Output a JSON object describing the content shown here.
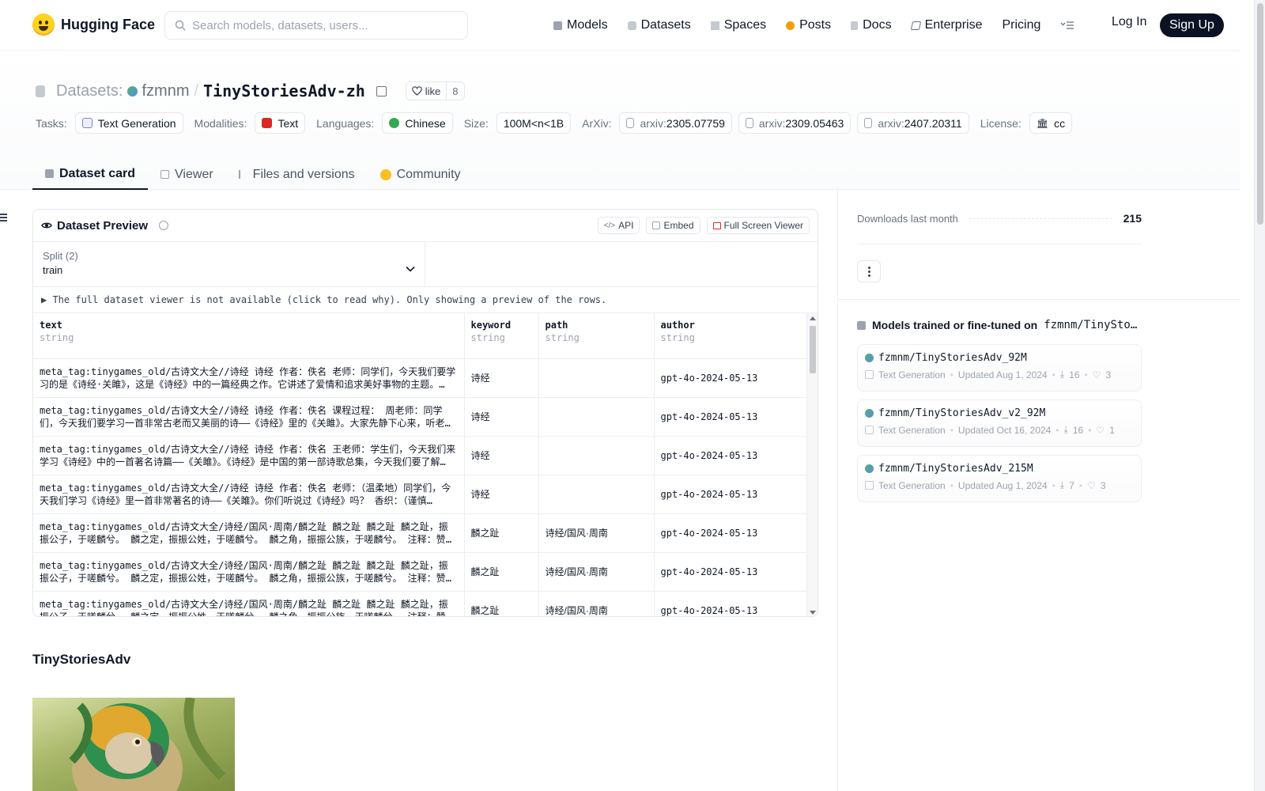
{
  "nav": {
    "brand": "Hugging Face",
    "search_placeholder": "Search models, datasets, users...",
    "links": [
      "Models",
      "Datasets",
      "Spaces",
      "Posts",
      "Docs",
      "Enterprise",
      "Pricing"
    ],
    "login": "Log In",
    "signup": "Sign Up"
  },
  "header": {
    "section": "Datasets:",
    "user": "fzmnm",
    "separator": "/",
    "repo": "TinyStoriesAdv-zh",
    "like_label": "like",
    "like_count": "8",
    "tags": {
      "tasks_label": "Tasks:",
      "task": "Text Generation",
      "modalities_label": "Modalities:",
      "modality": "Text",
      "languages_label": "Languages:",
      "language": "Chinese",
      "size_label": "Size:",
      "size": "100M<n<1B",
      "arxiv_label": "ArXiv:",
      "arxiv_prefix": "arxiv:",
      "arxiv": [
        "2305.07759",
        "2309.05463",
        "2407.20311"
      ],
      "license_label": "License:",
      "license": "cc"
    },
    "tabs": [
      "Dataset card",
      "Viewer",
      "Files and versions",
      "Community"
    ]
  },
  "preview": {
    "title": "Dataset Preview",
    "api": "API",
    "embed": "Embed",
    "fullscreen": "Full Screen Viewer",
    "split_label": "Split (2)",
    "split_value": "train",
    "notice": "▶ The full dataset viewer is not available (click to read why). Only showing a preview of the rows.",
    "columns": [
      {
        "name": "text",
        "type": "string"
      },
      {
        "name": "keyword",
        "type": "string"
      },
      {
        "name": "path",
        "type": "string"
      },
      {
        "name": "author",
        "type": "string"
      }
    ],
    "rows": [
      {
        "text": "meta_tag:tinygames_old/古诗文大全//诗经 诗经 作者：佚名 老师：同学们，今天我们要学习的是《诗经·关雎》，这是《诗经》中的一篇经典之作。它讲述了爱情和追求美好事物的主题。…",
        "keyword": "诗经",
        "path": "",
        "author": "gpt-4o-2024-05-13"
      },
      {
        "text": "meta_tag:tinygames_old/古诗文大全//诗经 诗经 作者：佚名 课程过程： 周老师：同学们，今天我们要学习一首非常古老而又美丽的诗——《诗经》里的《关雎》。大家先静下心来，听老师朗…",
        "keyword": "诗经",
        "path": "",
        "author": "gpt-4o-2024-05-13"
      },
      {
        "text": "meta_tag:tinygames_old/古诗文大全//诗经 诗经 作者：佚名 王老师：学生们，今天我们来学习《诗经》中的一首著名诗篇——《关雎》。《诗经》是中国的第一部诗歌总集，今天我们要了解…",
        "keyword": "诗经",
        "path": "",
        "author": "gpt-4o-2024-05-13"
      },
      {
        "text": "meta_tag:tinygames_old/古诗文大全//诗经 诗经 作者：佚名 老师：（温柔地）同学们，今天我们学习《诗经》里一首非常著名的诗——《关雎》。你们听说过《诗经》吗？ 香织：（谨慎…",
        "keyword": "诗经",
        "path": "",
        "author": "gpt-4o-2024-05-13"
      },
      {
        "text": "meta_tag:tinygames_old/古诗文大全/诗经/国风·周南/麟之趾 麟之趾 麟之趾 麟之趾，振振公子，于嗟麟兮。 麟之定，振振公姓，于嗟麟兮。 麟之角，振振公族，于嗟麟兮。 注释：赞美…",
        "keyword": "麟之趾",
        "path": "诗经/国风·周南",
        "author": "gpt-4o-2024-05-13"
      },
      {
        "text": "meta_tag:tinygames_old/古诗文大全/诗经/国风·周南/麟之趾 麟之趾 麟之趾 麟之趾，振振公子，于嗟麟兮。 麟之定，振振公姓，于嗟麟兮。 麟之角，振振公族，于嗟麟兮。 注释：赞美…",
        "keyword": "麟之趾",
        "path": "诗经/国风·周南",
        "author": "gpt-4o-2024-05-13"
      },
      {
        "text": "meta_tag:tinygames_old/古诗文大全/诗经/国风·周南/麟之趾 麟之趾 麟之趾 麟之趾，振振公子，于嗟麟兮。 麟之定，振振公姓，于嗟麟兮。 麟之角，振振公族，于嗟麟兮。 注释：赞美…",
        "keyword": "麟之趾",
        "path": "诗经/国风·周南",
        "author": "gpt-4o-2024-05-13"
      }
    ]
  },
  "card": {
    "heading": "TinyStoriesAdv"
  },
  "sidebar": {
    "downloads_label": "Downloads last month",
    "downloads": "215",
    "models_title_prefix": "Models trained or fine-tuned on",
    "models_title_repo": "fzmnm/TinyStoriesAdv-zh",
    "models": [
      {
        "name": "fzmnm/TinyStoriesAdv_92M",
        "task": "Text Generation",
        "updated": "Updated Aug 1, 2024",
        "downloads": "16",
        "likes": "3"
      },
      {
        "name": "fzmnm/TinyStoriesAdv_v2_92M",
        "task": "Text Generation",
        "updated": "Updated Oct 16, 2024",
        "downloads": "16",
        "likes": "1"
      },
      {
        "name": "fzmnm/TinyStoriesAdv_215M",
        "task": "Text Generation",
        "updated": "Updated Aug 1, 2024",
        "downloads": "7",
        "likes": "3"
      }
    ]
  },
  "colors": {
    "accent_dark": "#0b1224",
    "brand_yellow": "#FFD21E",
    "text_tag": "#dc2626"
  }
}
